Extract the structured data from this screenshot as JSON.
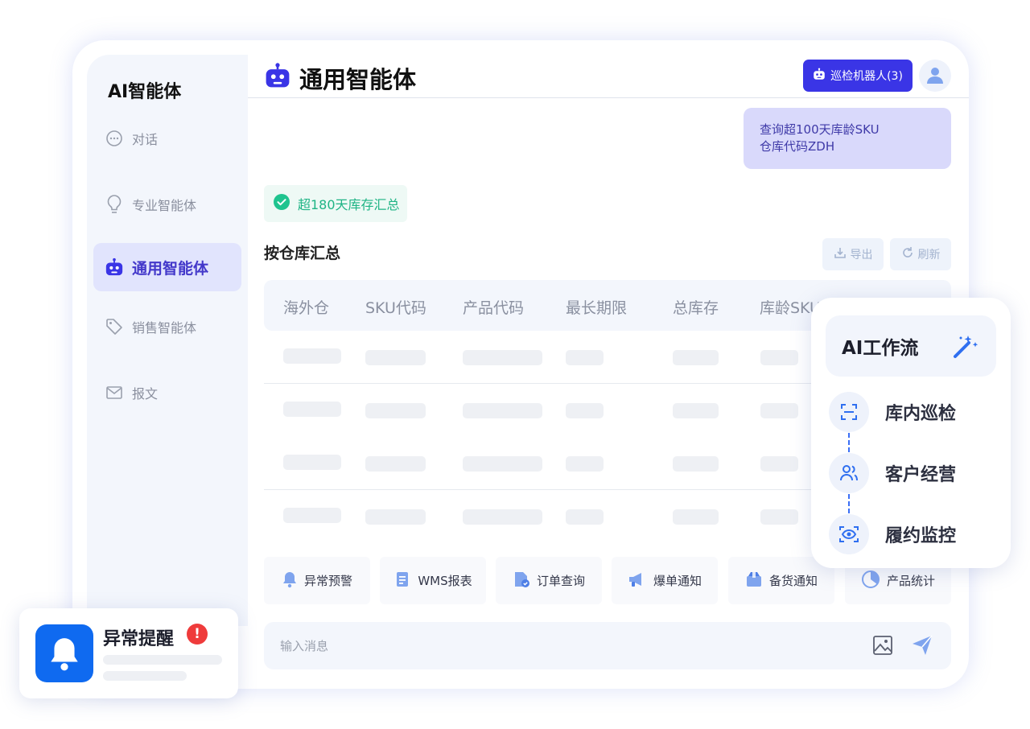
{
  "sidebar": {
    "app_title": "AI智能体",
    "items": [
      {
        "label": "对话",
        "icon": "chat-bubble-icon"
      },
      {
        "label": "专业智能体",
        "icon": "lightbulb-icon"
      },
      {
        "label": "通用智能体",
        "icon": "robot-icon",
        "active": true
      },
      {
        "label": "销售智能体",
        "icon": "tag-icon"
      },
      {
        "label": "报文",
        "icon": "mail-icon"
      }
    ]
  },
  "header": {
    "title": "通用智能体",
    "patrol_button": "巡检机器人(3)"
  },
  "chat": {
    "user_message": {
      "line1": "查询超100天库龄SKU",
      "line2": "仓库代码ZDH"
    },
    "status": "超180天库存汇总"
  },
  "report": {
    "title": "按仓库汇总",
    "export_label": "导出",
    "refresh_label": "刷新",
    "columns": [
      "海外仓",
      "SKU代码",
      "产品代码",
      "最长期限",
      "总库存",
      "库龄SKU"
    ],
    "row_count": 4
  },
  "quick_actions": [
    {
      "label": "异常预警",
      "icon": "bell-icon"
    },
    {
      "label": "WMS报表",
      "icon": "scroll-icon"
    },
    {
      "label": "订单查询",
      "icon": "document-check-icon"
    },
    {
      "label": "爆单通知",
      "icon": "megaphone-icon"
    },
    {
      "label": "备货通知",
      "icon": "box-icon"
    },
    {
      "label": "产品统计",
      "icon": "pie-chart-icon"
    }
  ],
  "input": {
    "placeholder": "输入消息"
  },
  "workflow": {
    "title": "AI工作流",
    "items": [
      {
        "label": "库内巡检",
        "icon": "scan-icon"
      },
      {
        "label": "客户经营",
        "icon": "users-icon"
      },
      {
        "label": "履约监控",
        "icon": "eye-scan-icon"
      }
    ]
  },
  "alert": {
    "title": "异常提醒",
    "badge": "!"
  },
  "colors": {
    "primary": "#3a35e6",
    "success": "#1fb485",
    "accent_blue": "#0f6af0",
    "danger": "#ef3b3b"
  }
}
